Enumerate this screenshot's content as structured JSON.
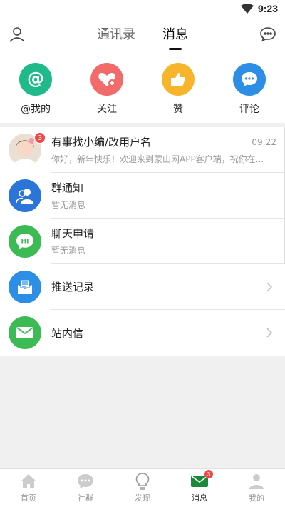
{
  "status_bar": {
    "time": "9:23"
  },
  "header": {
    "tabs": [
      {
        "label": "通讯录",
        "active": false
      },
      {
        "label": "消息",
        "active": true
      }
    ]
  },
  "quick_actions": [
    {
      "label": "@我的",
      "icon": "at-icon",
      "color": "#1fb98a"
    },
    {
      "label": "关注",
      "icon": "heart-plus-icon",
      "color": "#f26b6b"
    },
    {
      "label": "赞",
      "icon": "thumbs-up-icon",
      "color": "#f7b52c"
    },
    {
      "label": "评论",
      "icon": "chat-bubble-icon",
      "color": "#2d8ee6"
    }
  ],
  "messages": [
    {
      "title": "有事找小编/改用户名",
      "time": "09:22",
      "preview": "你好，新年快乐！欢迎来到蒙山网APP客户端，祝你在...",
      "badge": "3",
      "icon": "user-avatar"
    },
    {
      "title": "群通知",
      "preview": "暂无消息",
      "icon": "group-icon",
      "color": "#2b74d9"
    },
    {
      "title": "聊天申请",
      "preview": "暂无消息",
      "icon": "hi-chat-icon",
      "color": "#3cbb55"
    }
  ],
  "menu": [
    {
      "title": "推送记录",
      "icon": "push-record-icon",
      "color": "#2d8ee6"
    },
    {
      "title": "站内信",
      "icon": "mail-icon",
      "color": "#3cbb55"
    }
  ],
  "bottom_nav": [
    {
      "label": "首页",
      "icon": "home-icon",
      "active": false
    },
    {
      "label": "社群",
      "icon": "community-icon",
      "active": false
    },
    {
      "label": "发现",
      "icon": "bulb-icon",
      "active": false
    },
    {
      "label": "消息",
      "icon": "message-icon",
      "active": true,
      "badge": "3"
    },
    {
      "label": "我的",
      "icon": "profile-icon",
      "active": false
    }
  ]
}
